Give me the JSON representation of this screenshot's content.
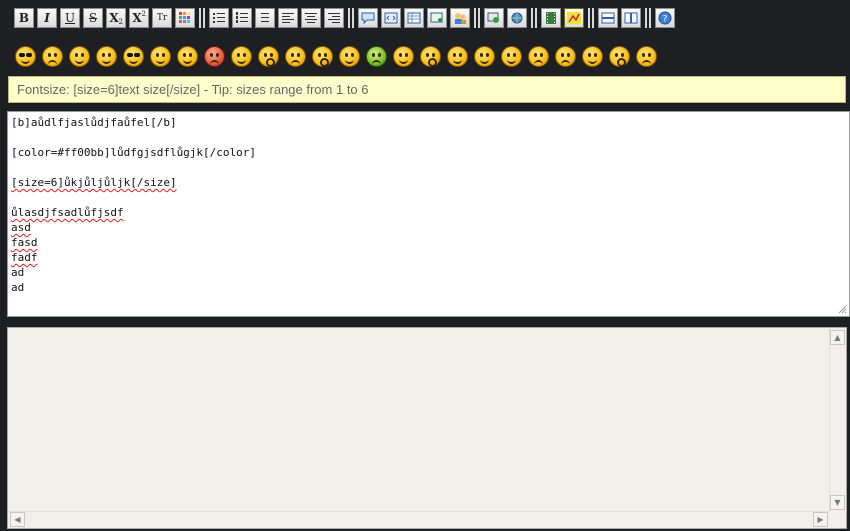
{
  "toolbar": {
    "buttons": [
      {
        "name": "bold-button",
        "glyph": "B",
        "style": "bold"
      },
      {
        "name": "italic-button",
        "glyph": "I",
        "style": "italic"
      },
      {
        "name": "underline-button",
        "glyph": "U",
        "style": "underline"
      },
      {
        "name": "strikethrough-button",
        "glyph": "S",
        "style": "strike"
      },
      {
        "name": "subscript-button",
        "glyph": "X",
        "style": "sub"
      },
      {
        "name": "superscript-button",
        "glyph": "X",
        "style": "sup"
      },
      {
        "name": "font-size-button",
        "glyph": "Tr",
        "style": "small"
      },
      {
        "name": "color-picker-button",
        "glyph": "",
        "style": "color"
      }
    ]
  },
  "tip": {
    "text": "Fontsize: [size=6]text size[/size] - Tip: sizes range from 1 to 6"
  },
  "editor": {
    "lines": [
      {
        "text": "[b]aůdlfjaslůdjfaůfel[/b]",
        "spell": false
      },
      {
        "text": "",
        "spell": false
      },
      {
        "text": "[color=#ff00bb]lůdfgjsdflůgjk[/color]",
        "spell": false
      },
      {
        "text": "",
        "spell": false
      },
      {
        "text": "[size=6]ůkjůljůljk[/size]",
        "spell": true
      },
      {
        "text": "",
        "spell": false
      },
      {
        "text": "ůlasdjfsadlůfjsdf",
        "spell": true
      },
      {
        "text": "asd",
        "spell": true
      },
      {
        "text": "fasd",
        "spell": true
      },
      {
        "text": "fadf",
        "spell": true
      },
      {
        "text": "ad",
        "spell": false
      },
      {
        "text": "ad",
        "spell": false
      }
    ]
  },
  "colors": {
    "background": "#1d1f23",
    "tip_background": "#ffffcc",
    "preview_background": "#f1efea"
  }
}
